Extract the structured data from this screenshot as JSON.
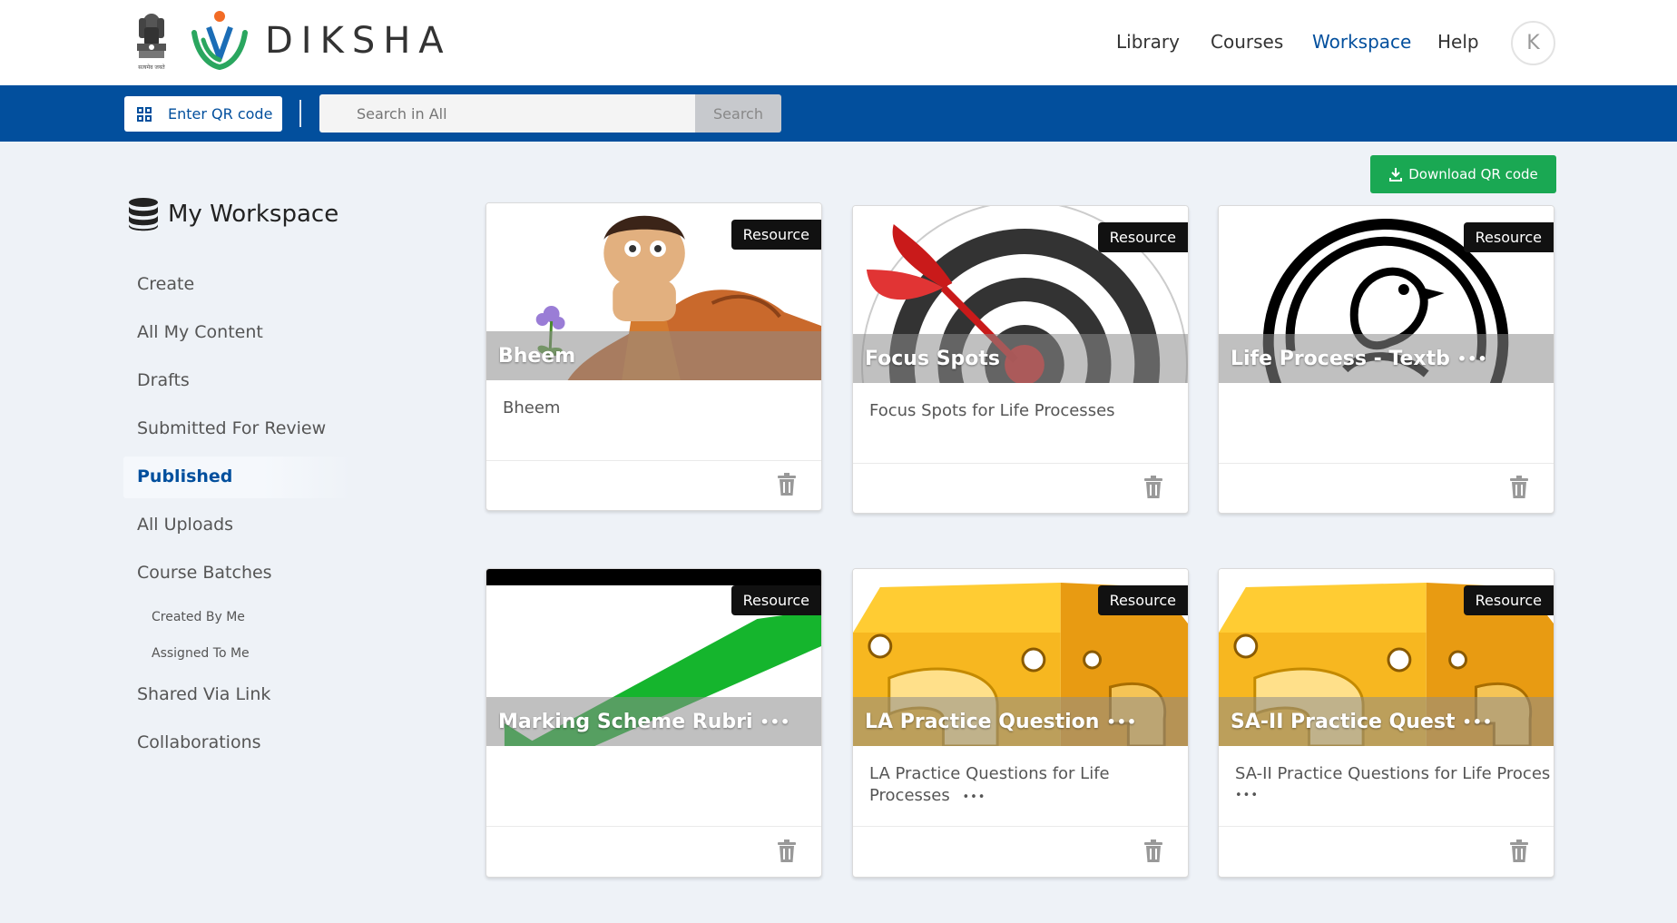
{
  "header": {
    "brand": "DIKSHA",
    "emblem_caption": "सत्यमेव जयते",
    "nav": [
      {
        "label": "Library",
        "active": false
      },
      {
        "label": "Courses",
        "active": false
      },
      {
        "label": "Workspace",
        "active": true
      },
      {
        "label": "Help",
        "active": false
      }
    ],
    "avatar_initial": "K"
  },
  "searchbar": {
    "qr_label": "Enter QR code",
    "search_placeholder": "Search in All",
    "search_button": "Search"
  },
  "actions": {
    "download_qr": "Download QR code"
  },
  "sidebar": {
    "title": "My Workspace",
    "items": [
      {
        "label": "Create"
      },
      {
        "label": "All My Content"
      },
      {
        "label": "Drafts"
      },
      {
        "label": "Submitted For Review"
      },
      {
        "label": "Published",
        "active": true
      },
      {
        "label": "All Uploads"
      },
      {
        "label": "Course Batches"
      },
      {
        "label": "Created By Me"
      },
      {
        "label": "Assigned To Me"
      },
      {
        "label": "Shared Via Link"
      },
      {
        "label": "Collaborations"
      }
    ]
  },
  "cards": [
    {
      "badge": "Resource",
      "title": "Bheem",
      "title_truncated": false,
      "description": "Bheem",
      "description_truncated": false
    },
    {
      "badge": "Resource",
      "title": "Focus Spots",
      "title_truncated": false,
      "description": "Focus Spots for Life Processes",
      "description_truncated": false
    },
    {
      "badge": "Resource",
      "title": "Life Process - Textb",
      "title_truncated": true,
      "description": "",
      "description_truncated": false
    },
    {
      "badge": "Resource",
      "title": "Marking Scheme Rubri",
      "title_truncated": true,
      "description": "",
      "description_truncated": false
    },
    {
      "badge": "Resource",
      "title": "LA Practice Question",
      "title_truncated": true,
      "description": "LA Practice Questions for Life Processes",
      "description_truncated": true
    },
    {
      "badge": "Resource",
      "title": "SA-II Practice Quest",
      "title_truncated": true,
      "description": "SA-II Practice Questions for Life Proces",
      "description_truncated": true
    }
  ],
  "ellipsis": "•••",
  "colors": {
    "primary": "#024f9d",
    "success": "#1aa853",
    "page_bg": "#eef2f7"
  }
}
